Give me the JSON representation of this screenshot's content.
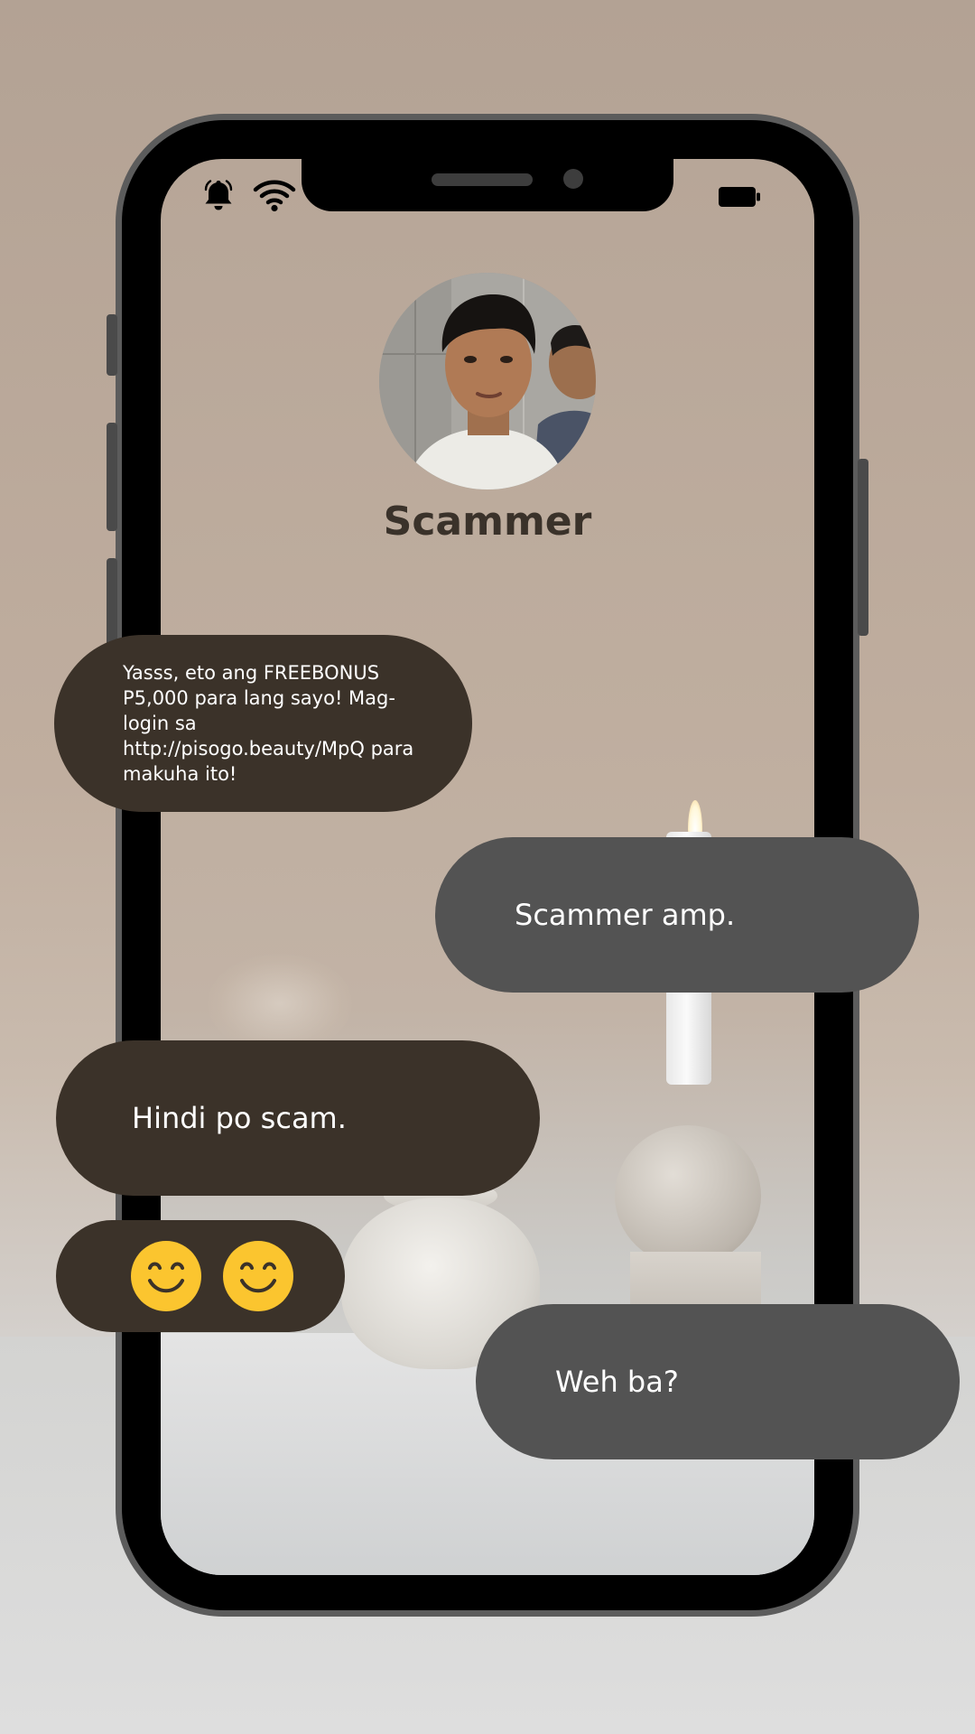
{
  "contact": {
    "name": "Scammer",
    "avatar_description": "profile photo"
  },
  "status_bar": {
    "left_icons": [
      "bell-icon",
      "wifi-icon"
    ],
    "right_icons": [
      "battery-icon"
    ]
  },
  "messages": [
    {
      "direction": "incoming",
      "text": "Yasss, eto ang FREEBONUS P5,000 para lang sayo! Mag-login sa http://pisogo.beauty/MpQ para makuha ito!"
    },
    {
      "direction": "outgoing",
      "text": "Scammer amp."
    },
    {
      "direction": "incoming",
      "text": "Hindi po scam."
    },
    {
      "direction": "incoming",
      "emoji": [
        "smiling-face-emoji",
        "smiling-face-emoji"
      ]
    },
    {
      "direction": "outgoing",
      "text": "Weh ba?"
    }
  ],
  "colors": {
    "incoming_bubble": "#3b3229",
    "outgoing_bubble": "#535353",
    "emoji_yellow": "#fbc52f",
    "name_text": "#3a322a"
  }
}
